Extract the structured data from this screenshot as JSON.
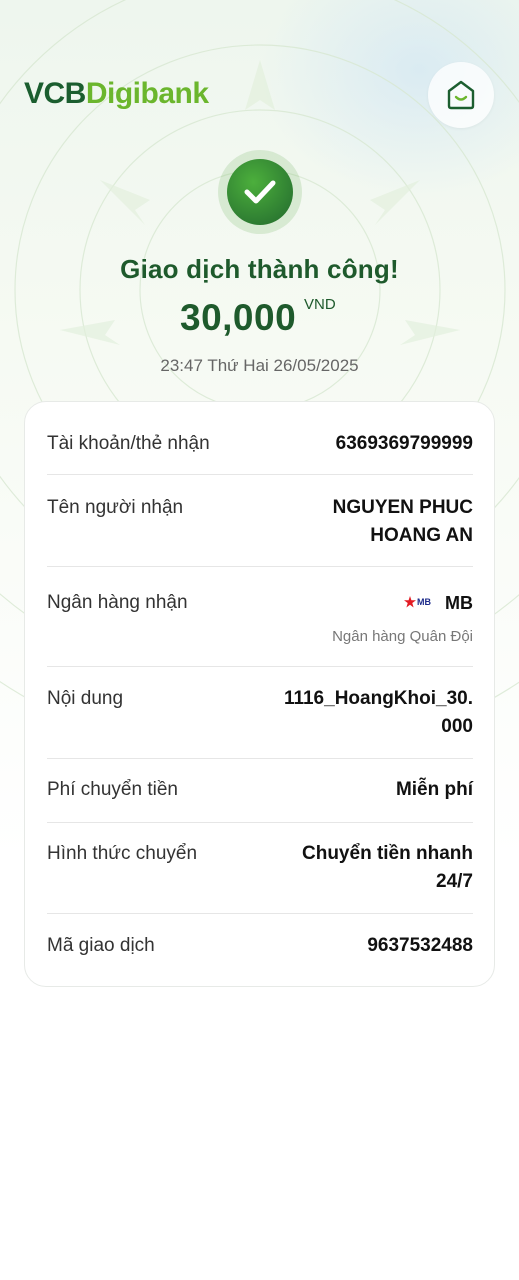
{
  "header": {
    "logo_part1": "VCB",
    "logo_part2": "Digibank",
    "home_icon": "home-icon"
  },
  "status": {
    "icon": "check-icon",
    "title": "Giao dịch thành công!",
    "amount": "30,000",
    "currency": "VND",
    "datetime": "23:47 Thứ Hai 26/05/2025"
  },
  "details": {
    "account_label": "Tài khoản/thẻ nhận",
    "account_value": "6369369799999",
    "recipient_label": "Tên người nhận",
    "recipient_line1": "NGUYEN PHUC",
    "recipient_line2": "HOANG AN",
    "bank_label": "Ngân hàng nhận",
    "bank_logo_text": "MB",
    "bank_value": "MB",
    "bank_fullname": "Ngân hàng Quân Đội",
    "content_label": "Nội dung",
    "content_line1": "1116_HoangKhoi_30.",
    "content_line2": "000",
    "fee_label": "Phí chuyển tiền",
    "fee_value": "Miễn phí",
    "method_label": "Hình thức chuyển",
    "method_line1": "Chuyển tiền nhanh",
    "method_line2": "24/7",
    "txn_label": "Mã giao dịch",
    "txn_value": "9637532488"
  },
  "colors": {
    "brand_dark": "#1b5e2f",
    "brand_light": "#6bb62d",
    "success": "#2e7d32"
  }
}
